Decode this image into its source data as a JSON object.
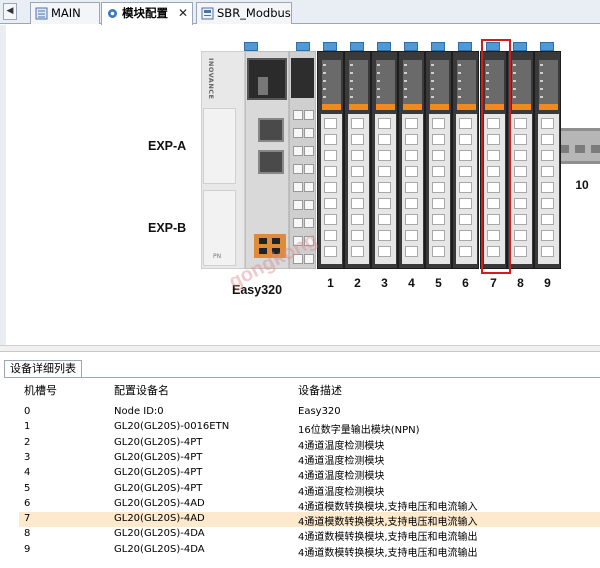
{
  "tabs": [
    {
      "label": "MAIN",
      "icon": "ladder-program-icon",
      "active": false
    },
    {
      "label": "模块配置",
      "icon": "module-config-icon",
      "active": true,
      "close": "✕"
    },
    {
      "label": "SBR_Modbus",
      "icon": "subroutine-icon",
      "active": false
    }
  ],
  "diagram": {
    "exp_a": "EXP-A",
    "exp_b": "EXP-B",
    "cpu_name": "Easy320",
    "brand": "INOVANCE",
    "pn_label": "PN",
    "module_numbers": [
      "1",
      "2",
      "3",
      "4",
      "5",
      "6",
      "7",
      "8",
      "9",
      "10"
    ],
    "selected_module": "7",
    "selected_color": "#d31d1d",
    "watermark": "gongkong"
  },
  "list": {
    "title": "设备详细列表",
    "columns": [
      "机槽号",
      "配置设备名",
      "设备描述"
    ],
    "rows": [
      [
        "0",
        "Node ID:0",
        "Easy320"
      ],
      [
        "1",
        "GL20(GL20S)-0016ETN",
        "16位数字量输出模块(NPN)"
      ],
      [
        "2",
        "GL20(GL20S)-4PT",
        "4通道温度检测模块"
      ],
      [
        "3",
        "GL20(GL20S)-4PT",
        "4通道温度检测模块"
      ],
      [
        "4",
        "GL20(GL20S)-4PT",
        "4通道温度检测模块"
      ],
      [
        "5",
        "GL20(GL20S)-4PT",
        "4通道温度检测模块"
      ],
      [
        "6",
        "GL20(GL20S)-4AD",
        "4通道模数转换模块,支持电压和电流输入"
      ],
      [
        "7",
        "GL20(GL20S)-4AD",
        "4通道模数转换模块,支持电压和电流输入"
      ],
      [
        "8",
        "GL20(GL20S)-4DA",
        "4通道数模转换模块,支持电压和电流输出"
      ],
      [
        "9",
        "GL20(GL20S)-4DA",
        "4通道数模转换模块,支持电压和电流输出"
      ]
    ],
    "selected_row": "7",
    "selected_color": "#fde9cc"
  }
}
